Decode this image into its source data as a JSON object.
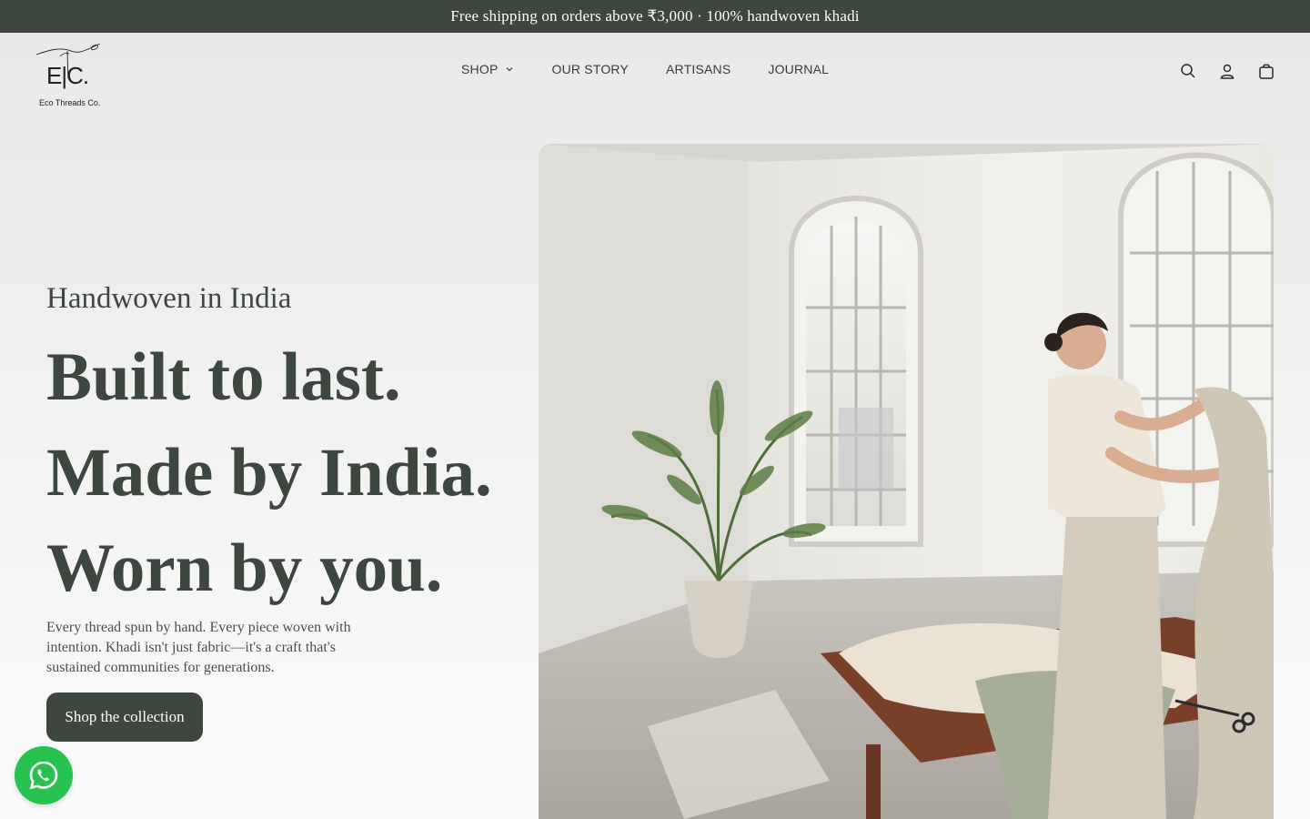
{
  "announcement": {
    "text": "Free shipping on orders above ₹3,000 · 100% handwoven khadi"
  },
  "brand": {
    "mark": "E|C.",
    "name": "Eco Threads Co."
  },
  "nav": {
    "items": [
      {
        "label": "SHOP",
        "has_dropdown": true
      },
      {
        "label": "OUR STORY",
        "has_dropdown": false
      },
      {
        "label": "ARTISANS",
        "has_dropdown": false
      },
      {
        "label": "JOURNAL",
        "has_dropdown": false
      }
    ]
  },
  "header_icons": [
    "search-icon",
    "account-icon",
    "cart-icon"
  ],
  "hero": {
    "eyebrow": "Handwoven in India",
    "headline": [
      "Built to last.",
      "Made by India.",
      "Worn by you."
    ],
    "body": "Every thread spun by hand. Every piece woven with intention. Khadi isn't just fabric—it's a craft that's sustained communities for generations.",
    "cta": "Shop the collection"
  },
  "floating": {
    "icon": "whatsapp-icon"
  },
  "colors": {
    "primary": "#3e473f",
    "announcement_bg": "#3e473f",
    "whatsapp": "#27c24f",
    "background": "#ececec"
  }
}
